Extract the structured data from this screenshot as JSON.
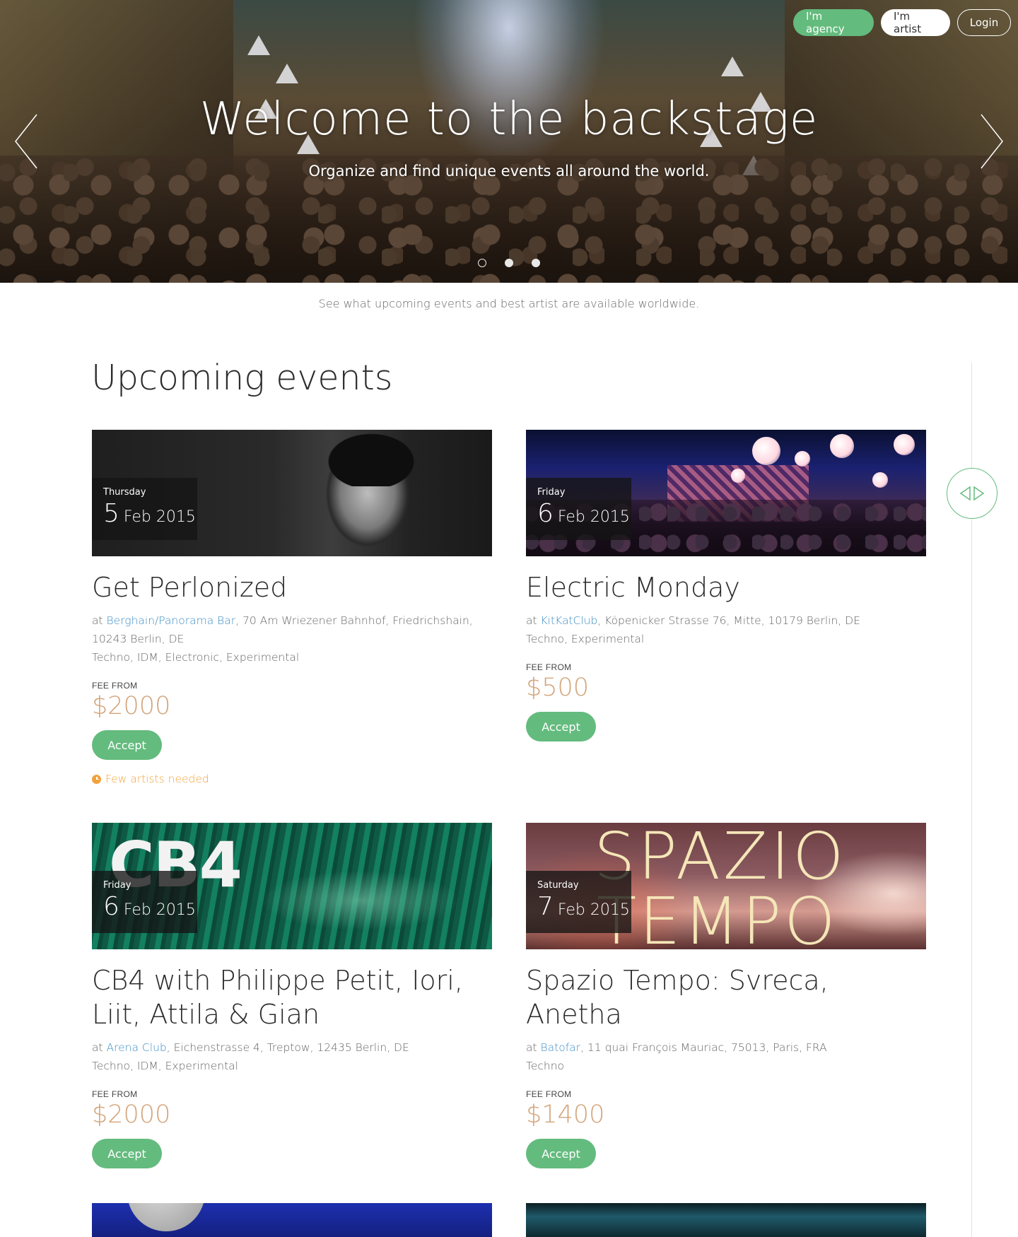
{
  "header": {
    "nav": {
      "agency_label": "I'm agency",
      "artist_label": "I'm artist",
      "login_label": "Login"
    }
  },
  "hero": {
    "title": "Welcome to the backstage",
    "subtitle": "Organize and find unique events all around the world.",
    "slides_count": 3,
    "active_slide": 1,
    "prev_icon": "chevron-left-icon",
    "next_icon": "chevron-right-icon"
  },
  "tagline": "See what upcoming events and best artist are available worldwide.",
  "section": {
    "title": "Upcoming events"
  },
  "colors": {
    "accent": "#64bb7e",
    "fee": "#d4a47a",
    "link": "#3f8fc5",
    "warning": "#f2a23a"
  },
  "events": [
    {
      "weekday": "Thursday",
      "day": "5",
      "month_year": "Feb 2015",
      "title": "Get Perlonized",
      "at": "at ",
      "venue": "Berghain/Panorama Bar",
      "address": ", 70 Am Wriezener Bahnhof, Friedrichshain, 10243 Berlin, DE",
      "genres": "Techno, IDM, Electronic, Experimental",
      "fee_label": "FEE FROM",
      "fee": "$2000",
      "accept_label": "Accept",
      "warning": "Few artists needed"
    },
    {
      "weekday": "Friday",
      "day": "6",
      "month_year": "Feb 2015",
      "title": "Electric Monday",
      "at": "at ",
      "venue": "KitKatClub",
      "address": ", Köpenicker Strasse 76, Mitte, 10179 Berlin, DE",
      "genres": "Techno, Experimental",
      "fee_label": "FEE FROM",
      "fee": "$500",
      "accept_label": "Accept"
    },
    {
      "weekday": "Friday",
      "day": "6",
      "month_year": "Feb 2015",
      "title": "CB4 with Philippe Petit, Iori, Liit, Attila & Gian",
      "image_text": "CB4",
      "at": "at ",
      "venue": "Arena Club",
      "address": ", Eichenstrasse 4, Treptow, 12435 Berlin, DE",
      "genres": "Techno, IDM, Experimental",
      "fee_label": "FEE FROM",
      "fee": "$2000",
      "accept_label": "Accept"
    },
    {
      "weekday": "Saturday",
      "day": "7",
      "month_year": "Feb 2015",
      "title": "Spazio Tempo: Svreca, Anetha",
      "image_text_1": "SPAZIO",
      "image_text_2": "TEMPO",
      "at": "at ",
      "venue": "Batofar",
      "address": ", 11 quai François Mauriac, 75013, Paris, FRA",
      "genres": "Techno",
      "fee_label": "FEE FROM",
      "fee": "$1400",
      "accept_label": "Accept"
    }
  ]
}
